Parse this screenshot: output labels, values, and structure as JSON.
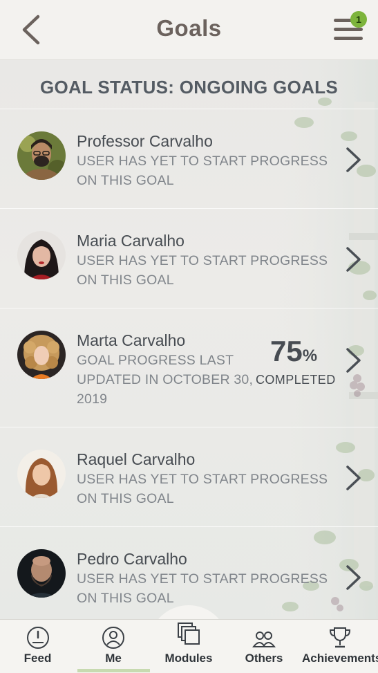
{
  "header": {
    "title": "Goals",
    "back_icon": "chevron-left-icon",
    "menu_icon": "hamburger-menu-icon",
    "notification_count": "1"
  },
  "section": {
    "title": "GOAL STATUS: ONGOING GOALS"
  },
  "goals": [
    {
      "name": "Professor Carvalho",
      "status_line1": "USER HAS YET TO START PROGRESS",
      "status_line2": "ON THIS GOAL",
      "status_line3": ""
    },
    {
      "name": "Maria Carvalho",
      "status_line1": "USER HAS YET TO START PROGRESS",
      "status_line2": "ON THIS GOAL",
      "status_line3": ""
    },
    {
      "name": "Marta Carvalho",
      "status_line1": "GOAL PROGRESS LAST",
      "status_line2": "UPDATED IN OCTOBER 30,",
      "status_line3": "2019",
      "progress_value": "75",
      "progress_unit": "%",
      "progress_label": "COMPLETED"
    },
    {
      "name": "Raquel Carvalho",
      "status_line1": "USER HAS YET TO START PROGRESS",
      "status_line2": "ON THIS GOAL",
      "status_line3": ""
    },
    {
      "name": "Pedro Carvalho",
      "status_line1": "USER HAS YET TO START PROGRESS",
      "status_line2": "ON THIS GOAL",
      "status_line3": ""
    }
  ],
  "tabs": [
    {
      "label": "Feed",
      "icon": "gauge-icon"
    },
    {
      "label": "Me",
      "icon": "user-icon",
      "active": true
    },
    {
      "label": "Modules",
      "icon": "stacked-squares-icon"
    },
    {
      "label": "Others",
      "icon": "users-icon"
    },
    {
      "label": "Achievements",
      "icon": "trophy-icon"
    }
  ],
  "colors": {
    "title": "#6b625d",
    "text": "#474c52",
    "muted": "#80858b",
    "badge": "#7db43c",
    "active_tab": "#c7dab0"
  }
}
